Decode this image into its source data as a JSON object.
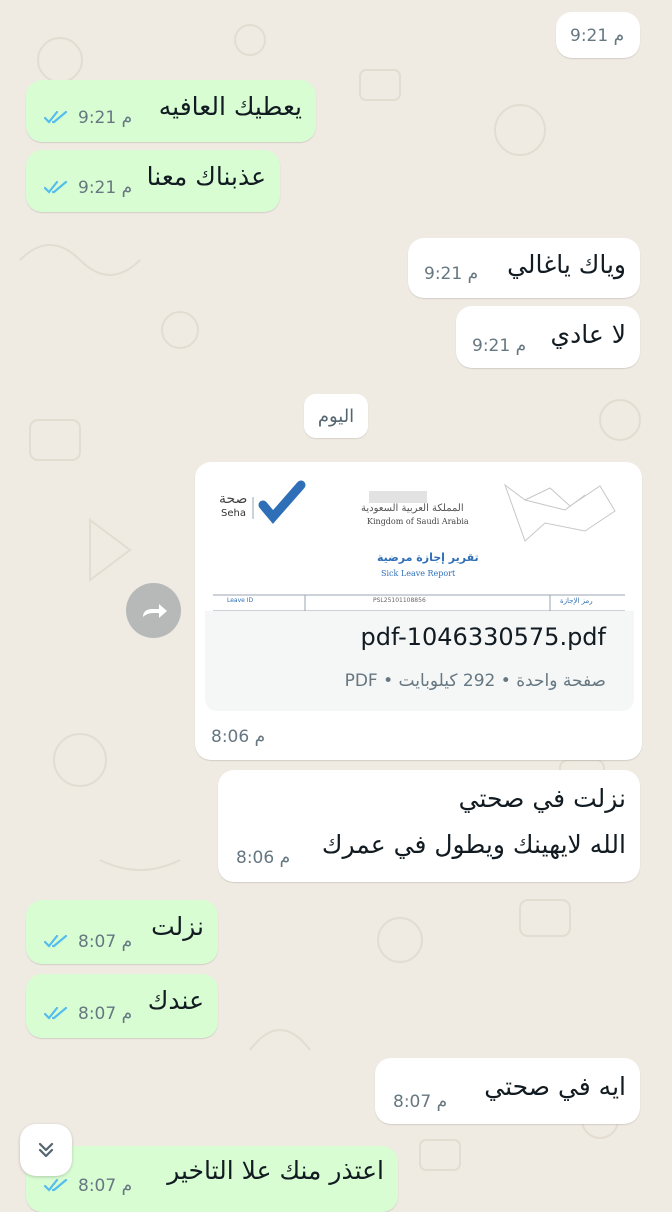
{
  "colors": {
    "background": "#efeae2",
    "sent_bubble": "#d9fdd3",
    "received_bubble": "#ffffff",
    "read_ticks": "#53bdeb",
    "meta_text": "#667781",
    "seha_blue": "#2f6fb7"
  },
  "ticks_icon": "double-check-read-icon",
  "messages": [
    {
      "id": "m0",
      "direction": "received",
      "text": "",
      "time": "9:21 م"
    },
    {
      "id": "m1",
      "direction": "sent",
      "text": "يعطيك العافيه",
      "time": "9:21 م",
      "ticks": "read"
    },
    {
      "id": "m2",
      "direction": "sent",
      "text": "عذبناك معنا",
      "time": "9:21 م",
      "ticks": "read"
    },
    {
      "id": "m3",
      "direction": "received",
      "text": "وياك ياغالي",
      "time": "9:21 م"
    },
    {
      "id": "m4",
      "direction": "received",
      "text": "لا عادي",
      "time": "9:21 م"
    },
    {
      "id": "m5",
      "direction": "received",
      "text": "نزلت في صحتي",
      "text2": "الله لايهينك ويطول في عمرك",
      "time": "8:06 م"
    },
    {
      "id": "m6",
      "direction": "sent",
      "text": "نزلت",
      "time": "8:07 م",
      "ticks": "read"
    },
    {
      "id": "m7",
      "direction": "sent",
      "text": "عندك",
      "time": "8:07 م",
      "ticks": "read"
    },
    {
      "id": "m8",
      "direction": "received",
      "text": "ايه في صحتي",
      "time": "8:07 م"
    },
    {
      "id": "m9",
      "direction": "sent",
      "text": "اعتذر منك علا التاخير",
      "time": "8:07 م",
      "ticks": "read"
    }
  ],
  "date_separator": "اليوم",
  "document": {
    "filename": "pdf-1046330575.pdf",
    "info": "صفحة واحدة • 292 كيلوبايت • PDF",
    "time": "8:06 م",
    "preview": {
      "seha_arabic": "صحة",
      "seha_latin": "Seha",
      "kingdom_arabic": "المملكة العربية السعودية",
      "kingdom_english": "Kingdom of Saudi Arabia",
      "report_title_arabic": "تقرير إجازة مرضية",
      "report_title_english": "Sick Leave Report",
      "leave_id_label": "Leave ID",
      "leave_id_value": "PSL25101108856",
      "leave_id_label_arabic": "رمز الإجازة"
    }
  },
  "buttons": {
    "forward_icon": "forward-arrow-icon",
    "scroll_down_icon": "double-chevron-down-icon"
  }
}
